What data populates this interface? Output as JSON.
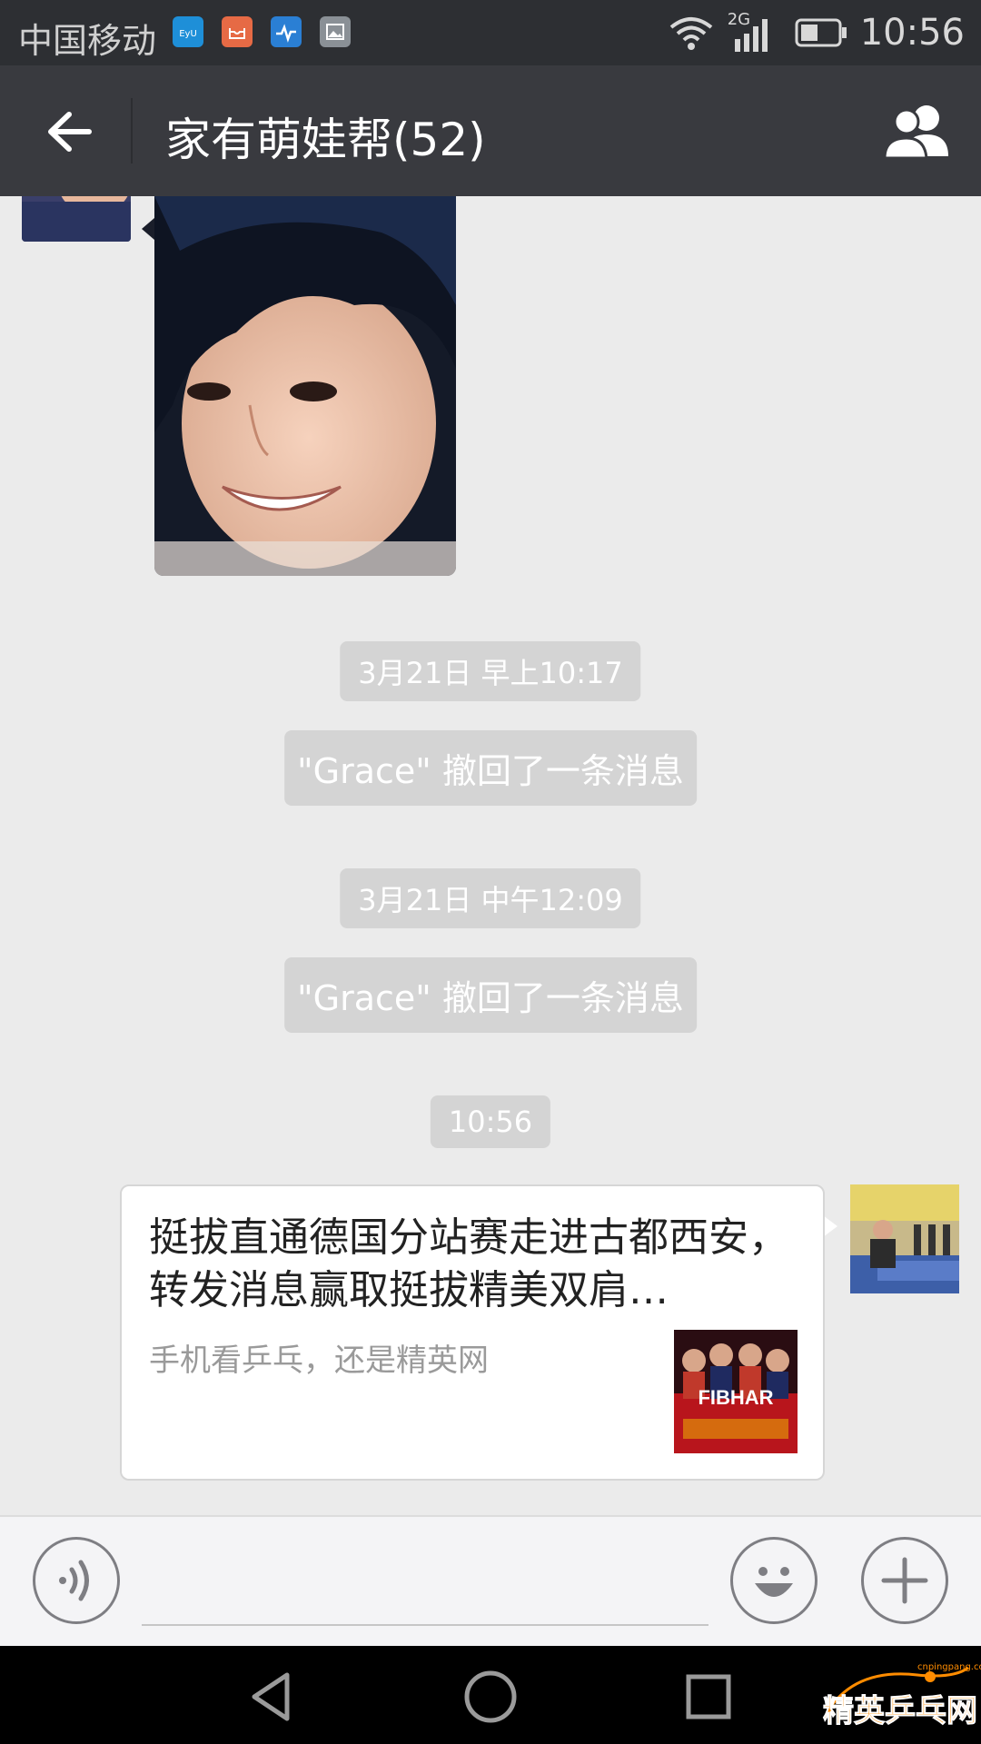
{
  "status_bar": {
    "carrier": "中国移动",
    "network": "2G",
    "time": "10:56",
    "icons": [
      "app-icon-blue",
      "mail-icon",
      "health-icon",
      "gallery-icon",
      "wifi-icon",
      "signal-icon",
      "battery-icon"
    ]
  },
  "header": {
    "title": "家有萌娃帮(52)",
    "back_icon": "arrow-left-icon",
    "members_icon": "group-members-icon"
  },
  "messages": {
    "ts1": "3月21日 早上10:17",
    "recall1": "\"Grace\" 撤回了一条消息",
    "ts2": "3月21日 中午12:09",
    "recall2": "\"Grace\" 撤回了一条消息",
    "ts3": "10:56",
    "card_title": "挺拔直通德国分站赛走进古都西安，转发消息赢取挺拔精美双肩…",
    "card_subtitle": "手机看乒乓，还是精英网",
    "card_thumb_text": "FIBHAR"
  },
  "input_bar": {
    "voice_icon": "voice-icon",
    "emoji_icon": "emoji-icon",
    "plus_icon": "plus-icon"
  },
  "watermark": {
    "main": "精英乒乓网",
    "url": "cnpingpang.com"
  },
  "colors": {
    "status_bar": "#2d2f33",
    "header": "#393a3f",
    "chat_bg": "#ebebeb",
    "chip_bg": "#d4d4d4",
    "input_bar": "#f4f4f6"
  }
}
